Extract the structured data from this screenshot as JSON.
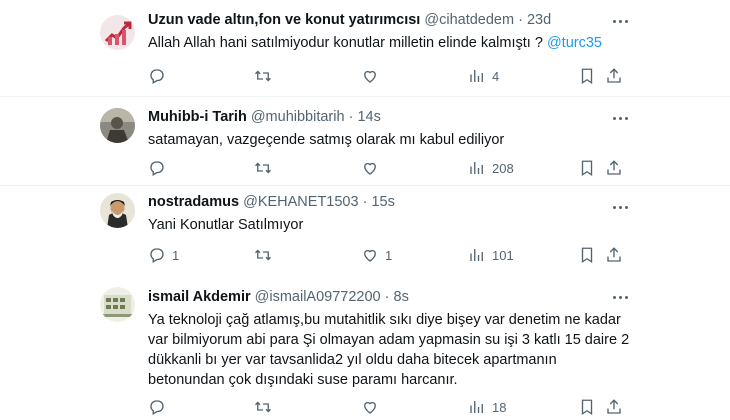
{
  "tweets": [
    {
      "name": "Uzun vade altın,fon ve konut yatırımcısı",
      "handle": "@cihatdedem",
      "time": "23d",
      "text": "Allah Allah hani satılmiyodur konutlar milletin elinde kalmıştı ? ",
      "mention": "@turc35",
      "replies": "",
      "retweets": "",
      "likes": "",
      "views": "4"
    },
    {
      "name": "Muhibb-i Tarih",
      "handle": "@muhibbitarih",
      "time": "14s",
      "text": "satamayan, vazgeçende satmış olarak mı kabul ediliyor",
      "mention": "",
      "replies": "",
      "retweets": "",
      "likes": "",
      "views": "208"
    },
    {
      "name": "nostradamus",
      "handle": "@KEHANET1503",
      "time": "15s",
      "text": "Yani Konutlar Satılmıyor",
      "mention": "",
      "replies": "1",
      "retweets": "",
      "likes": "1",
      "views": "101"
    },
    {
      "name": "ismail Akdemir",
      "handle": "@ismailA09772200",
      "time": "8s",
      "text": "Ya teknoloji çağ atlamış,bu mutahitlik sıkı diye bişey var denetim ne kadar var bilmiyorum abi para Şi olmayan adam yapmasin su işi 3 katlı 15 daire 2 dükkanli bı yer var tavsanlida2 yıl oldu daha bitecek apartmanın betonundan çok dışındaki suse paramı harcanır.",
      "mention": "",
      "replies": "",
      "retweets": "",
      "likes": "",
      "views": "18"
    }
  ],
  "colors": {
    "text": "#0f1419",
    "secondary": "#536471",
    "link": "#1d9bf0",
    "divider": "#eff3f4"
  },
  "icons": [
    "reply-icon",
    "retweet-icon",
    "like-icon",
    "views-icon",
    "bookmark-icon",
    "share-icon",
    "more-icon"
  ]
}
